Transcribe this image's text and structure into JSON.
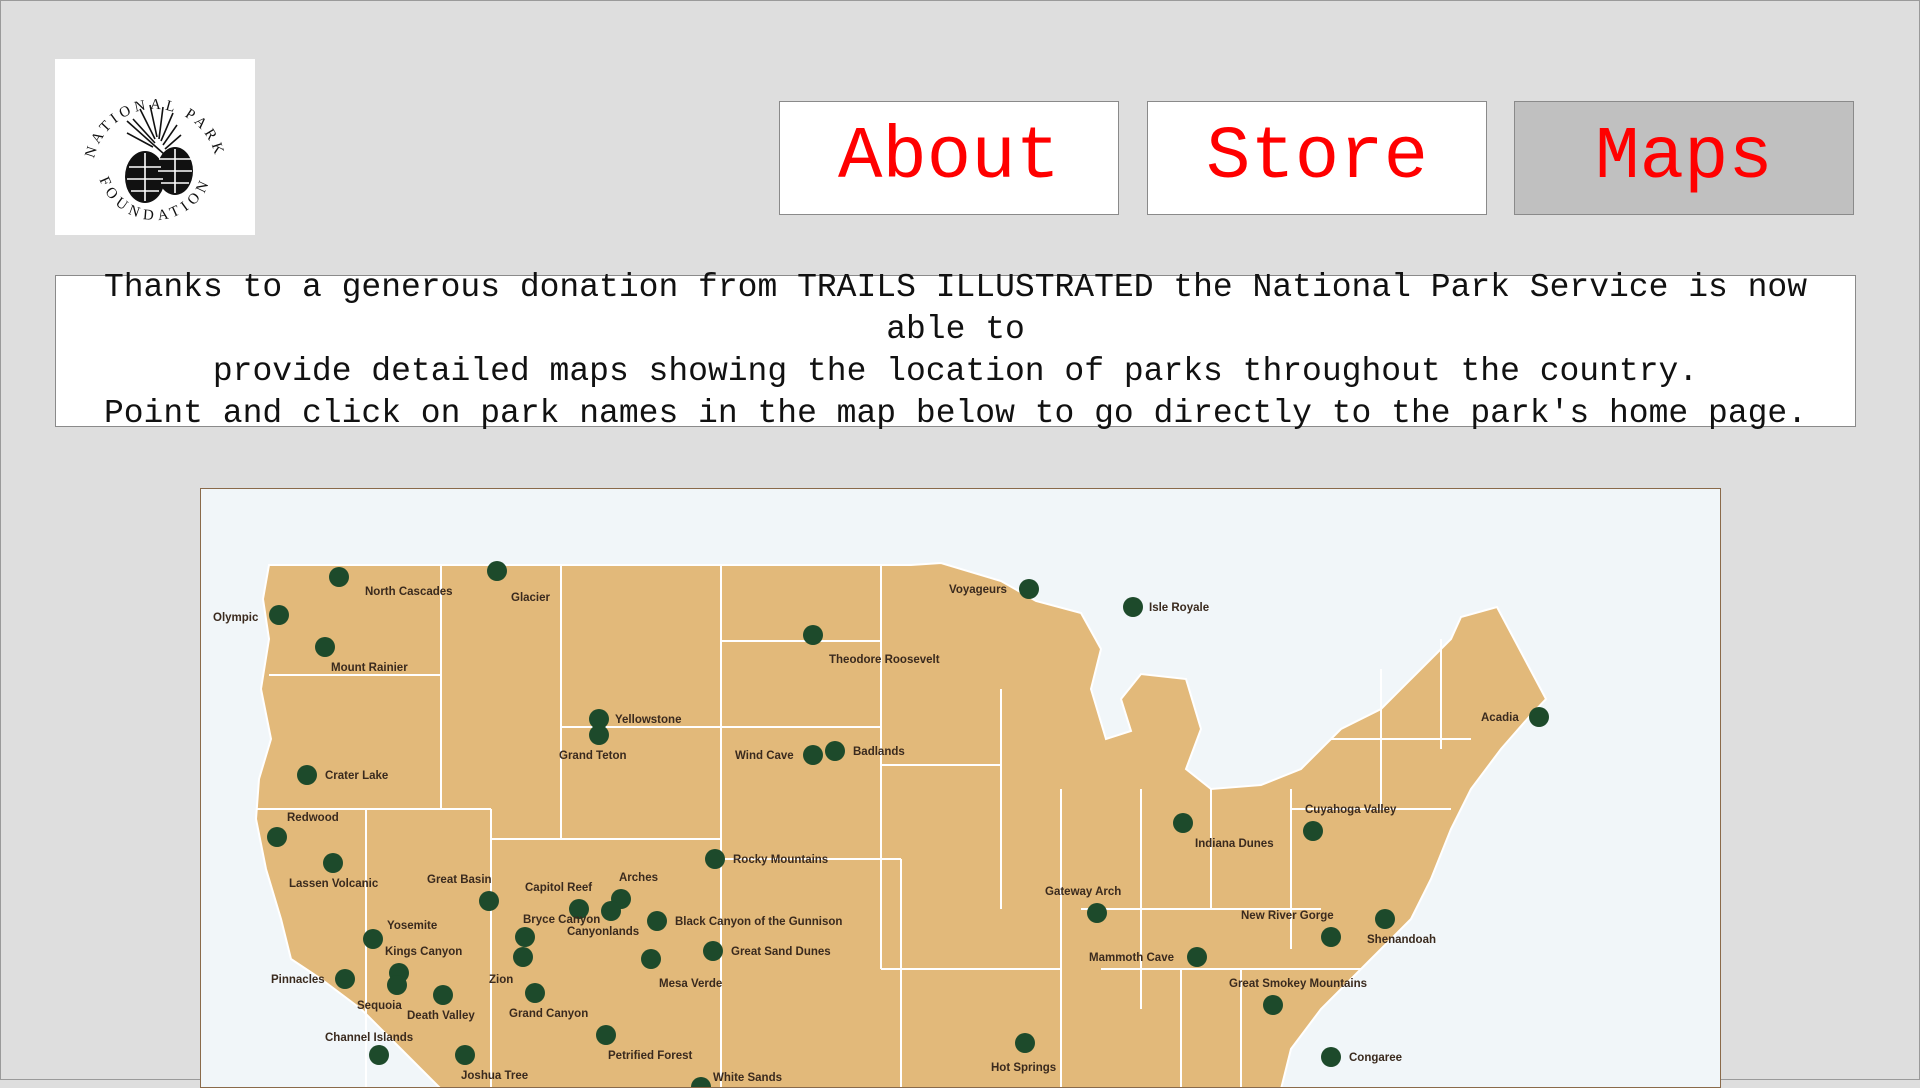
{
  "logo": {
    "top_text": "NATIONAL PARK",
    "bottom_text": "FOUNDATION"
  },
  "nav": {
    "about_label": "About",
    "store_label": "Store",
    "maps_label": "Maps",
    "active": "Maps",
    "text_color": "#ff0000"
  },
  "intro": {
    "line1": "Thanks to a generous donation from TRAILS ILLUSTRATED the National Park Service is now able to",
    "line2": "provide detailed maps showing the location of parks throughout the country.",
    "line3": "Point and click on park names in the map below to go directly to the park's home page."
  },
  "map": {
    "land_color": "#e2b97a",
    "water_color": "#f1f6f9",
    "marker_color": "#1d4a2b",
    "parks": [
      "North Cascades",
      "Glacier",
      "Olympic",
      "Mount Rainier",
      "Voyageurs",
      "Isle Royale",
      "Theodore Roosevelt",
      "Yellowstone",
      "Grand Teton",
      "Wind Cave",
      "Badlands",
      "Acadia",
      "Crater Lake",
      "Redwood",
      "Lassen Volcanic",
      "Great Basin",
      "Capitol Reef",
      "Arches",
      "Canyonlands",
      "Bryce Canyon",
      "Zion",
      "Rocky Mountains",
      "Black Canyon of the Gunnison",
      "Great Sand Dunes",
      "Mesa Verde",
      "Yosemite",
      "Kings Canyon",
      "Pinnacles",
      "Sequoia",
      "Death Valley",
      "Channel Islands",
      "Joshua Tree",
      "Grand Canyon",
      "Petrified Forest",
      "White Sands",
      "Hot Springs",
      "Gateway Arch",
      "Mammoth Cave",
      "Indiana Dunes",
      "Cuyahoga Valley",
      "New River Gorge",
      "Shenandoah",
      "Great Smokey Mountains",
      "Congaree"
    ]
  }
}
